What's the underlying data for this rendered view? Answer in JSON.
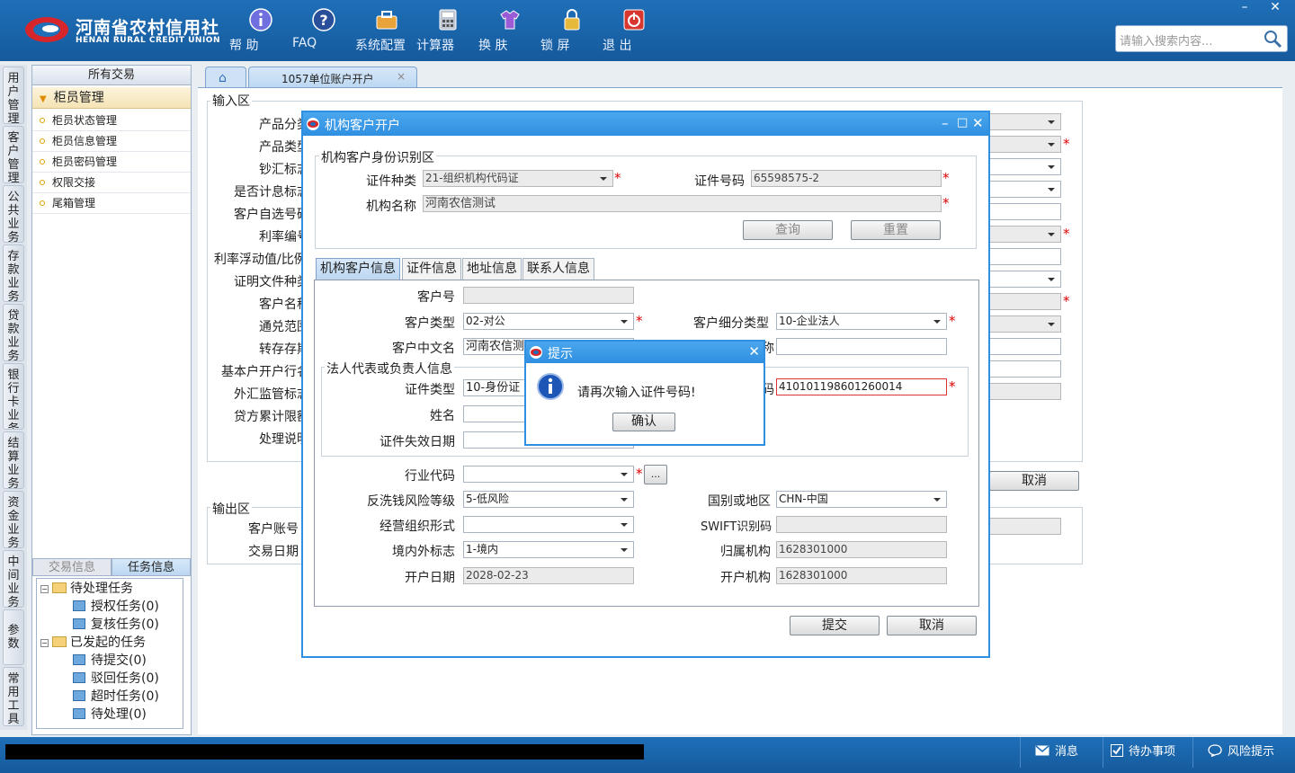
{
  "app": {
    "logo_cn": "河南省农村信用社",
    "logo_en": "HENAN RURAL CREDIT UNION",
    "toolbar": [
      {
        "label": "帮 助",
        "icon": "info-icon"
      },
      {
        "label": "FAQ",
        "icon": "help-icon"
      },
      {
        "label": "系统配置",
        "icon": "toolbox-icon"
      },
      {
        "label": "计算器",
        "icon": "calculator-icon"
      },
      {
        "label": "换 肤",
        "icon": "shirt-icon"
      },
      {
        "label": "锁 屏",
        "icon": "lock-icon"
      },
      {
        "label": "退 出",
        "icon": "power-icon"
      }
    ],
    "window_controls": {
      "minimize": "–",
      "close": "✕"
    },
    "search_placeholder": "请输入搜索内容..."
  },
  "vnav": [
    "用户管理",
    "客户管理",
    "公共业务",
    "存款业务",
    "贷款业务",
    "银行卡业务",
    "结算业务",
    "资金业务",
    "中间业务",
    "参数",
    "常用工具"
  ],
  "leftpanel": {
    "header": "所有交易",
    "group": "柜员管理",
    "items": [
      "柜员状态管理",
      "柜员信息管理",
      "柜员密码管理",
      "权限交接",
      "尾箱管理"
    ],
    "tabs": [
      "交易信息",
      "任务信息"
    ],
    "tree": [
      {
        "label": "待处理任务",
        "type": "folder"
      },
      {
        "label": "授权任务(0)",
        "type": "doc"
      },
      {
        "label": "复核任务(0)",
        "type": "doc"
      },
      {
        "label": "已发起的任务",
        "type": "folder"
      },
      {
        "label": "待提交(0)",
        "type": "doc"
      },
      {
        "label": "驳回任务(0)",
        "type": "doc"
      },
      {
        "label": "超时任务(0)",
        "type": "doc"
      },
      {
        "label": "待处理(0)",
        "type": "doc"
      }
    ]
  },
  "tabs": {
    "home_icon": "home-icon",
    "active": "1057单位账户开户",
    "close": "×"
  },
  "form": {
    "input_title": "输入区",
    "labels": [
      "产品分类",
      "产品类型",
      "钞汇标志",
      "是否计息标志",
      "客户自选号码",
      "利率编号",
      "利率浮动值/比例",
      "证明文件种类",
      "客户名称",
      "通兑范围",
      "转存存期",
      "基本户开户行名",
      "外汇监管标志",
      "贷方累计限额",
      "处理说明"
    ],
    "output_title": "输出区",
    "output_labels": [
      "客户账号",
      "交易日期"
    ],
    "cancel": "取消"
  },
  "dialog": {
    "title": "机构客户开户",
    "ctl": [
      "–",
      "□",
      "✕"
    ],
    "id_section": "机构客户身份识别区",
    "id_type_label": "证件种类",
    "id_type_value": "21-组织机构代码证",
    "id_no_label": "证件号码",
    "id_no_value": "65598575-2",
    "org_name_label": "机构名称",
    "org_name_value": "河南农信测试",
    "query": "查询",
    "reset": "重置",
    "subtabs": [
      "机构客户信息",
      "证件信息",
      "地址信息",
      "联系人信息"
    ],
    "cust_no_label": "客户号",
    "cust_type_label": "客户类型",
    "cust_type_value": "02-对公",
    "cust_subtype_label": "客户细分类型",
    "cust_subtype_value": "10-企业法人",
    "cust_cn_label": "客户中文名",
    "cust_cn_value": "河南农信测",
    "right_label_fragment": "称",
    "legal_section": "法人代表或负责人信息",
    "legal_id_type_label": "证件类型",
    "legal_id_type_value": "10-身份证",
    "legal_id_no_fragment": "码",
    "legal_id_no_value": "410101198601260014",
    "name_label": "姓名",
    "expire_label": "证件失效日期",
    "industry_label": "行业代码",
    "industry_btn": "...",
    "aml_label": "反洗钱风险等级",
    "aml_value": "5-低风险",
    "country_label": "国别或地区",
    "country_value": "CHN-中国",
    "org_form_label": "经营组织形式",
    "swift_label": "SWIFT识别码",
    "domestic_label": "境内外标志",
    "domestic_value": "1-境内",
    "belong_label": "归属机构",
    "belong_value": "1628301000",
    "open_date_label": "开户日期",
    "open_date_value": "2028-02-23",
    "open_org_label": "开户机构",
    "open_org_value": "1628301000",
    "submit": "提交",
    "cancel": "取消"
  },
  "prompt": {
    "title": "提示",
    "close": "✕",
    "message": "请再次输入证件号码!",
    "ok": "确认"
  },
  "statusbar": {
    "messages": "消息",
    "todo": "待办事项",
    "risk": "风险提示"
  },
  "colors": {
    "topbar": "#1f6fb8",
    "dialog_border": "#2f8fe0",
    "required": "#d00000"
  }
}
